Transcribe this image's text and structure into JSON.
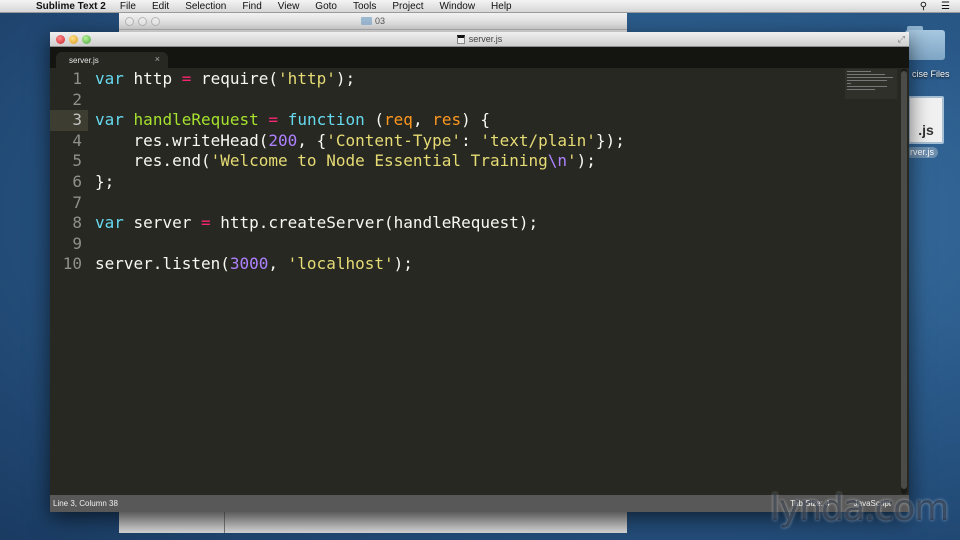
{
  "menubar": {
    "apple_icon": "apple-icon",
    "app_name": "Sublime Text 2",
    "items": [
      "File",
      "Edit",
      "Selection",
      "Find",
      "View",
      "Goto",
      "Tools",
      "Project",
      "Window",
      "Help"
    ],
    "right_icons": [
      "spotlight-search-icon",
      "notification-list-icon"
    ]
  },
  "finder_window": {
    "title": "03"
  },
  "desktop": {
    "folder_label": "cise Files",
    "file_icon_text": ".js",
    "file_label": "rver.js"
  },
  "editor_window": {
    "title": "server.js",
    "tabs": [
      {
        "label": "server.js",
        "close": "×",
        "active": true
      }
    ],
    "active_line": 3,
    "lines": [
      {
        "n": "1",
        "code": "var http = require('http');"
      },
      {
        "n": "2",
        "code": ""
      },
      {
        "n": "3",
        "code": "var handleRequest = function (req, res) {"
      },
      {
        "n": "4",
        "code": "    res.writeHead(200, {'Content-Type': 'text/plain'});"
      },
      {
        "n": "5",
        "code": "    res.end('Welcome to Node Essential Training\\n');"
      },
      {
        "n": "6",
        "code": "};"
      },
      {
        "n": "7",
        "code": ""
      },
      {
        "n": "8",
        "code": "var server = http.createServer(handleRequest);"
      },
      {
        "n": "9",
        "code": ""
      },
      {
        "n": "10",
        "code": "server.listen(3000, 'localhost');"
      }
    ],
    "status": {
      "position": "Line 3, Column 38",
      "tab_size": "Tab Size: 4",
      "syntax": "JavaScript"
    },
    "colors": {
      "background": "#272822",
      "keyword": "#66d9ef",
      "function_name": "#a6e22e",
      "operator": "#f92672",
      "string": "#e6db74",
      "number": "#ae81ff",
      "parameter": "#fd971f"
    }
  },
  "watermark": "lynda.com"
}
